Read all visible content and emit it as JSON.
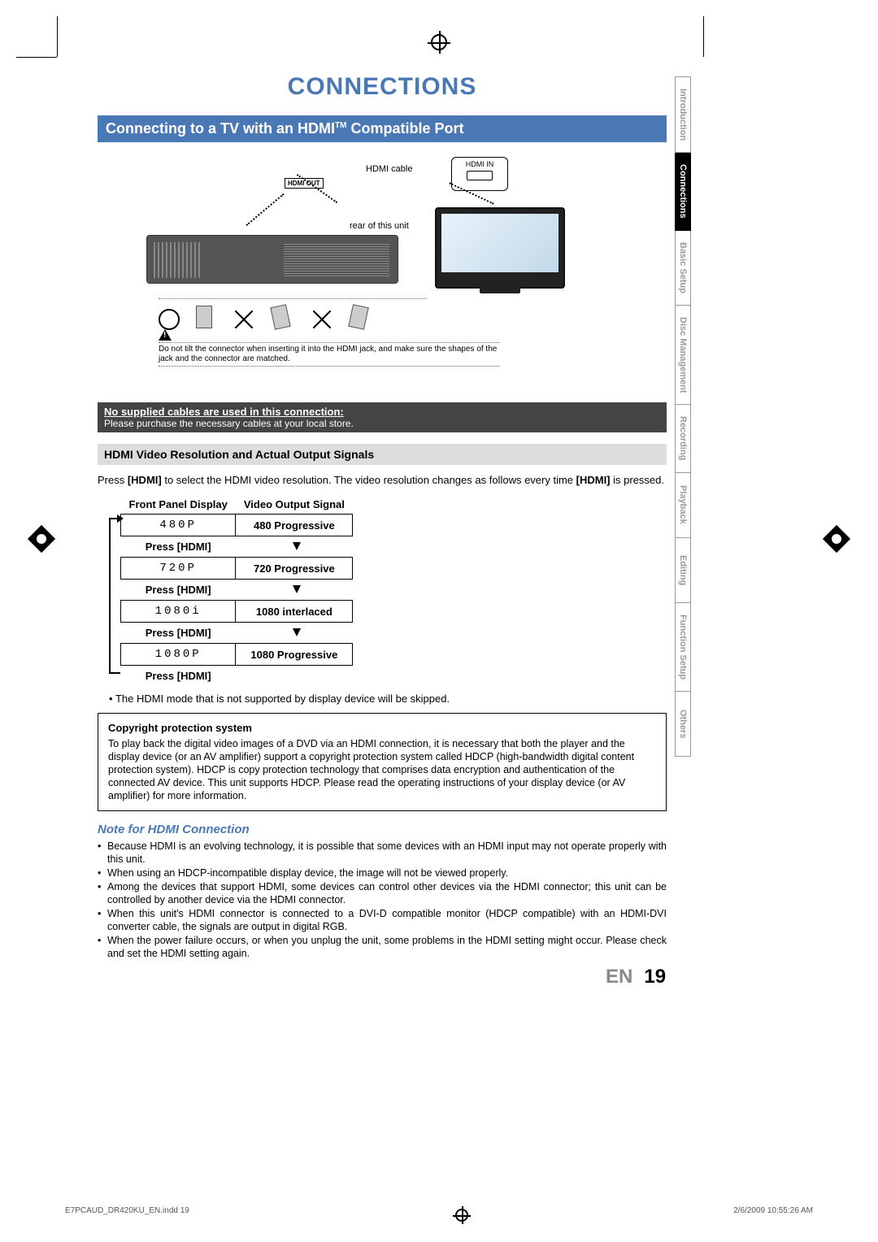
{
  "title": "CONNECTIONS",
  "section_heading_pre": "Connecting to a TV with an HDMI",
  "section_heading_tm": "TM",
  "section_heading_post": " Compatible Port",
  "diagram": {
    "hdmi_cable": "HDMI cable",
    "hdmi_out": "HDMI OUT",
    "rear_label": "rear of this unit",
    "hdmi_in": "HDMI IN",
    "tilt_note": "Do not tilt the connector when inserting it into the HDMI jack, and make sure the shapes of the jack and the connector are matched."
  },
  "dark_bar": {
    "line1": "No supplied cables are used in this connection:",
    "line2": "Please purchase the necessary cables at your local store."
  },
  "gray_bar": "HDMI Video Resolution and Actual Output Signals",
  "press_intro_pre": "Press ",
  "press_intro_hdmi": "[HDMI]",
  "press_intro_mid": " to select the HDMI video resolution. The video resolution changes as follows every time ",
  "press_intro_hdmi2": "[HDMI]",
  "press_intro_post": " is pressed.",
  "table": {
    "head_left": "Front Panel Display",
    "head_right": "Video Output Signal",
    "rows": [
      {
        "display": "480P",
        "signal": "480 Progressive"
      },
      {
        "display": "720P",
        "signal": "720 Progressive"
      },
      {
        "display": "1080i",
        "signal": "1080 interlaced"
      },
      {
        "display": "1080P",
        "signal": "1080 Progressive"
      }
    ],
    "press_label": "Press [HDMI]"
  },
  "hdmi_skip_note": "The HDMI mode that is not supported by display device will be skipped.",
  "box": {
    "title": "Copyright protection system",
    "body": "To play back the digital video images of a DVD via an HDMI connection, it is necessary that both the player and the display device (or an AV amplifier) support a copyright protection system called HDCP (high-bandwidth digital content protection system). HDCP is copy protection technology that comprises data encryption and authentication of the connected AV device. This unit supports HDCP. Please read the operating instructions of your display device (or AV amplifier) for more information."
  },
  "note_heading": "Note for HDMI Connection",
  "notes": [
    "Because HDMI is an evolving technology, it is possible that some devices with an HDMI input may not operate properly with this unit.",
    "When using an HDCP-incompatible display device, the image will not be viewed properly.",
    "Among the devices that support HDMI, some devices can control other devices via the HDMI connector; this unit can be controlled by another device via the HDMI connector.",
    "When this unit's HDMI connector is connected to a DVI-D compatible monitor (HDCP compatible) with an HDMI-DVI converter cable, the signals are output in digital RGB.",
    "When the power failure occurs, or when you unplug the unit, some problems in the HDMI setting might occur. Please check and set the HDMI setting again."
  ],
  "page_footer": {
    "lang": "EN",
    "num": "19"
  },
  "tabs": [
    "Introduction",
    "Connections",
    "Basic Setup",
    "Disc Management",
    "Recording",
    "Playback",
    "Editing",
    "Function Setup",
    "Others"
  ],
  "active_tab": "Connections",
  "print_footer": {
    "left": "E7PCAUD_DR420KU_EN.indd   19",
    "right": "2/6/2009   10:55:26 AM"
  }
}
